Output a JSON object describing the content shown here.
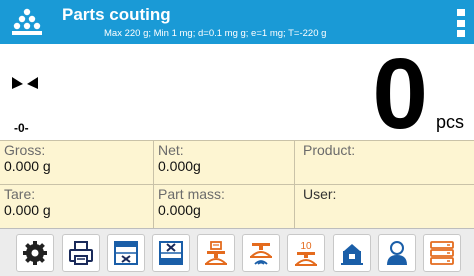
{
  "header": {
    "title": "Parts couting",
    "subtitle": "Max 220 g; Min 1 mg; d=0.1 mg g; e=1 mg; T=-220 g",
    "app_icon": "parts-counting-icon",
    "menu_icon": "more-vertical-icon"
  },
  "reading": {
    "value": "0",
    "unit": "pcs",
    "zero_indicator": "-0-",
    "stability_icon": "stability-marker-icon"
  },
  "info": {
    "gross": {
      "label": "Gross:",
      "value": "0.000 g"
    },
    "net": {
      "label": "Net:",
      "value": "0.000g"
    },
    "product": {
      "label": "Product:",
      "value": ""
    },
    "tare": {
      "label": "Tare:",
      "value": "0.000 g"
    },
    "part_mass": {
      "label": "Part mass:",
      "value": "0.000g"
    },
    "user": {
      "label": "User:",
      "value": ""
    }
  },
  "toolbar": {
    "buttons": [
      {
        "icon": "settings-gear-icon"
      },
      {
        "icon": "print-icon"
      },
      {
        "icon": "tare-icon"
      },
      {
        "icon": "zero-icon"
      },
      {
        "icon": "scale-header-icon"
      },
      {
        "icon": "scale-footer-icon"
      },
      {
        "icon": "reference-sample-icon",
        "text": "10"
      },
      {
        "icon": "tare-weighing-icon"
      },
      {
        "icon": "user-icon"
      },
      {
        "icon": "database-icon"
      }
    ]
  },
  "colors": {
    "header_bg": "#1a9ad6",
    "info_bg": "#fdf5d2",
    "icon_blue": "#1a5ea8",
    "icon_orange": "#e46b1e"
  }
}
